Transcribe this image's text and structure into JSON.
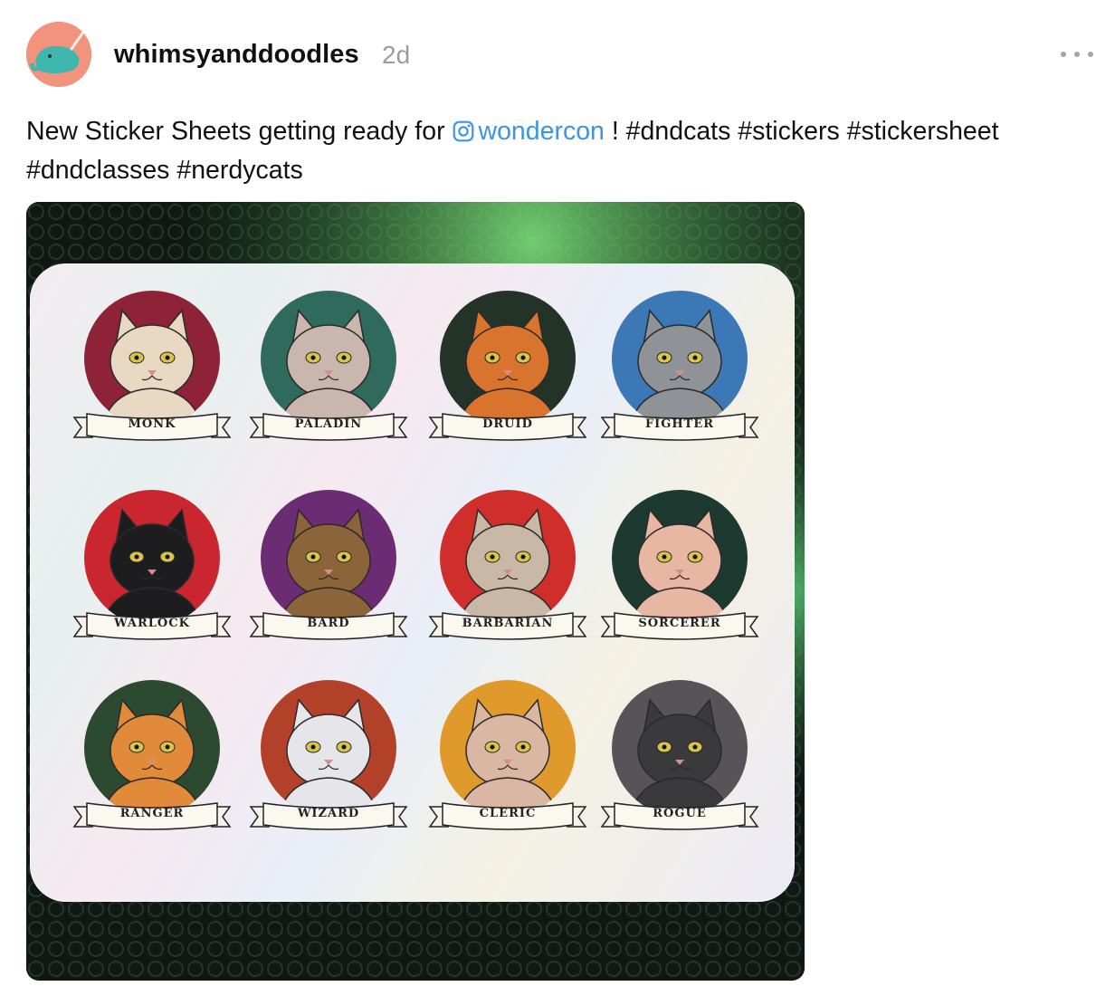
{
  "post": {
    "username": "whimsyanddoodles",
    "time_ago": "2d",
    "avatar_icon": "narwhal-logo-icon",
    "avatar_color": "#f1937d",
    "more_icon": "more-options-icon"
  },
  "caption": {
    "text_before": "New Sticker Sheets getting ready for ",
    "mention": "wondercon",
    "mention_icon": "instagram-icon",
    "text_after": " ! #dndcats #stickers #stickersheet #dndclasses #nerdycats",
    "link_color": "#3d93e6"
  },
  "photo": {
    "stickers": [
      {
        "label": "MONK",
        "color": "#8e2236",
        "fur": "#e9d8c2"
      },
      {
        "label": "PALADIN",
        "color": "#2f6a5c",
        "fur": "#c9b7ad"
      },
      {
        "label": "DRUID",
        "color": "#243327",
        "fur": "#d9742e"
      },
      {
        "label": "FIGHTER",
        "color": "#3b78b5",
        "fur": "#8f9297"
      },
      {
        "label": "WARLOCK",
        "color": "#c92630",
        "fur": "#1d1d1f"
      },
      {
        "label": "BARD",
        "color": "#6b2c73",
        "fur": "#8c643a"
      },
      {
        "label": "BARBARIAN",
        "color": "#cf2e2a",
        "fur": "#c9b8a6"
      },
      {
        "label": "SORCERER",
        "color": "#1d3a30",
        "fur": "#e8b7a4"
      },
      {
        "label": "RANGER",
        "color": "#2c4a30",
        "fur": "#e08a3a"
      },
      {
        "label": "WIZARD",
        "color": "#b3412a",
        "fur": "#e6e6ea"
      },
      {
        "label": "CLERIC",
        "color": "#e09a2c",
        "fur": "#d9b7a2"
      },
      {
        "label": "ROGUE",
        "color": "#565459",
        "fur": "#3a3a3c"
      }
    ]
  }
}
